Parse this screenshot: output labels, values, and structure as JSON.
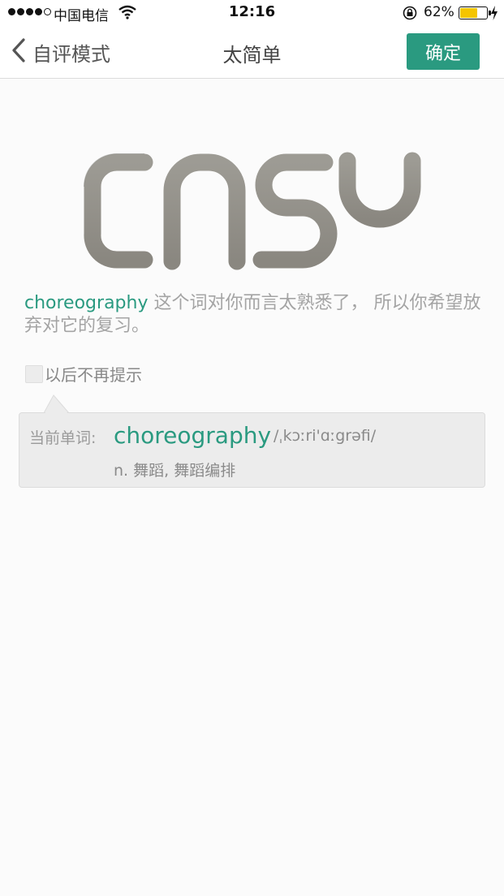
{
  "status_bar": {
    "carrier": "中国电信",
    "time": "12:16",
    "battery_percent_text": "62%",
    "battery_level": 0.62
  },
  "nav": {
    "back_label": "自评模式",
    "title": "太简单",
    "confirm_label": "确定"
  },
  "hero": {
    "text": "EASY"
  },
  "description": {
    "word": "choreography",
    "text": " 这个词对你而言太熟悉了， 所以你希望放弃对它的复习。"
  },
  "reminder": {
    "label": "以后不再提示",
    "checked": false
  },
  "word_card": {
    "label": "当前单词:",
    "word": "choreography",
    "phonetic": "/ˌkɔːri'ɑːgrəfi/",
    "definition": "n. 舞蹈, 舞蹈编排"
  },
  "colors": {
    "accent": "#2a9a80",
    "muted_text": "#a4a4a4",
    "card_bg": "#ececec",
    "battery": "#f5c500"
  }
}
